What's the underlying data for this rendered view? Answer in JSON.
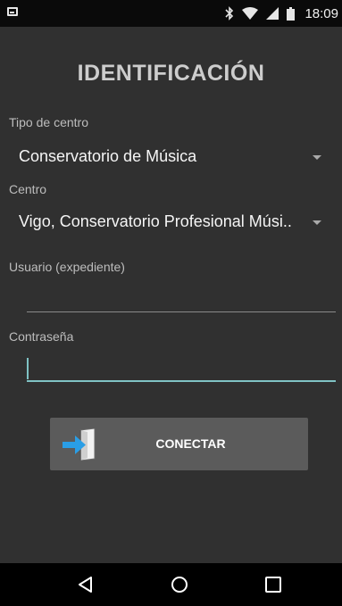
{
  "status_bar": {
    "time": "18:09",
    "icons": [
      "notification-icon",
      "bluetooth-icon",
      "wifi-icon",
      "signal-icon",
      "battery-icon"
    ]
  },
  "screen": {
    "title": "IDENTIFICACIÓN"
  },
  "form": {
    "tipo_centro": {
      "label": "Tipo de centro",
      "value": "Conservatorio de Música"
    },
    "centro": {
      "label": "Centro",
      "value": "Vigo, Conservatorio Profesional Músi.."
    },
    "usuario": {
      "label": "Usuario (expediente)",
      "value": "",
      "placeholder": ""
    },
    "contrasena": {
      "label": "Contraseña",
      "value": "",
      "placeholder": ""
    },
    "connect_button": {
      "label": "CONECTAR",
      "icon": "login-door-icon"
    }
  },
  "nav_bar": {
    "icons": [
      "back-icon",
      "home-icon",
      "recents-icon"
    ]
  },
  "colors": {
    "background": "#303030",
    "status_bar": "#0a0a0a",
    "nav_bar": "#000000",
    "accent": "#7fc2c4",
    "button": "#5b5b5b",
    "title": "#cdcdcd"
  }
}
